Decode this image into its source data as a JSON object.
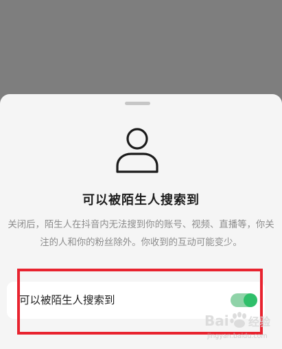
{
  "sheet": {
    "title": "可以被陌生人搜索到",
    "description": "关闭后，陌生人在抖音内无法搜到你的账号、视频、直播等，你关注的人和你的粉丝除外。你收到的互动可能变少。",
    "icon": "person-outline-icon"
  },
  "setting": {
    "label": "可以被陌生人搜索到",
    "enabled": true,
    "toggle_on_color": "#2fbf6a",
    "toggle_track_color": "#8fd3a8"
  },
  "annotation": {
    "highlight_color": "#e8232f"
  },
  "watermark": {
    "brand": "Bai 经验",
    "url": "jingyan.baidu.com"
  }
}
